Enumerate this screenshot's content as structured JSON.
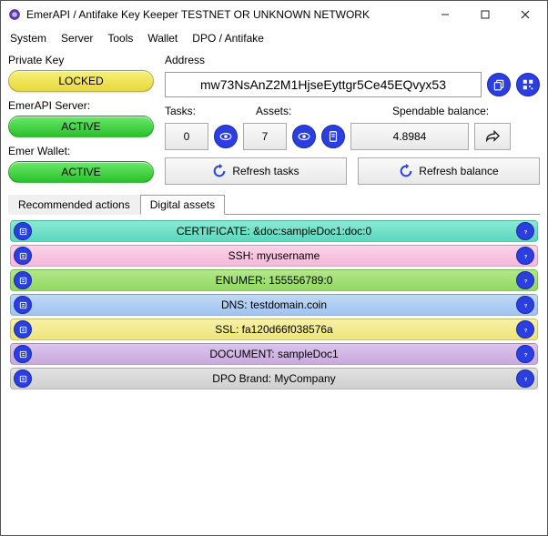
{
  "window": {
    "title": "EmerAPI / Antifake Key Keeper TESTNET OR UNKNOWN NETWORK"
  },
  "menu": [
    "System",
    "Server",
    "Tools",
    "Wallet",
    "DPO / Antifake"
  ],
  "left": {
    "private_key_label": "Private Key",
    "private_key_status": "LOCKED",
    "server_label": "EmerAPI Server:",
    "server_status": "ACTIVE",
    "wallet_label": "Emer Wallet:",
    "wallet_status": "ACTIVE"
  },
  "right": {
    "address_label": "Address",
    "address_value": "mw73NsAnZ2M1HjseEyttgr5Ce45EQvyx53",
    "tasks_label": "Tasks:",
    "tasks_value": "0",
    "assets_label": "Assets:",
    "assets_value": "7",
    "balance_label": "Spendable balance:",
    "balance_value": "4.8984",
    "refresh_tasks": "Refresh tasks",
    "refresh_balance": "Refresh balance"
  },
  "tabs": {
    "recommended": "Recommended actions",
    "digital": "Digital assets"
  },
  "assets": [
    {
      "text": "CERTIFICATE: &doc:sampleDoc1:doc:0",
      "color": "c-teal"
    },
    {
      "text": "SSH: myusername",
      "color": "c-pink"
    },
    {
      "text": "ENUMER: 155556789:0",
      "color": "c-green"
    },
    {
      "text": "DNS: testdomain.coin",
      "color": "c-blue"
    },
    {
      "text": "SSL: fa120d66f038576a",
      "color": "c-yellow"
    },
    {
      "text": "DOCUMENT: sampleDoc1",
      "color": "c-purple"
    },
    {
      "text": "DPO Brand: MyCompany",
      "color": "c-grey"
    }
  ]
}
